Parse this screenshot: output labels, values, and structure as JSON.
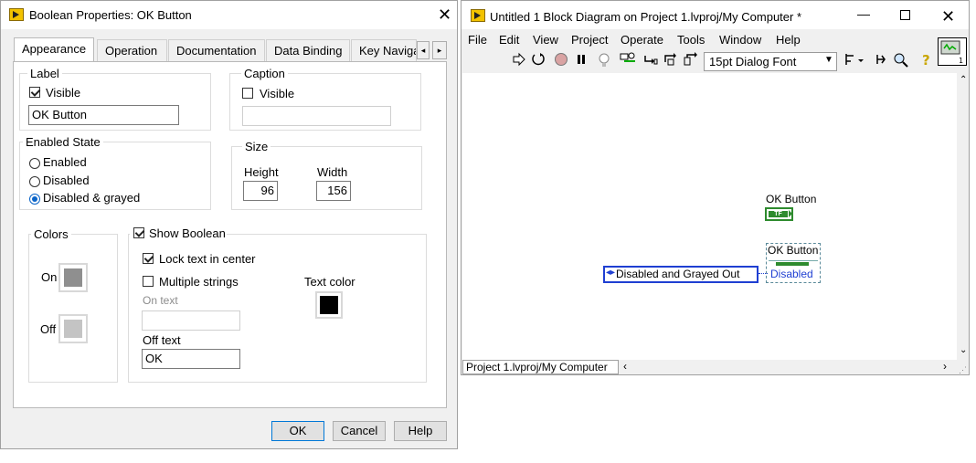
{
  "dialog": {
    "title": "Boolean Properties: OK Button",
    "tabs": [
      "Appearance",
      "Operation",
      "Documentation",
      "Data Binding",
      "Key Naviga"
    ],
    "label": {
      "legend": "Label",
      "visible_label": "Visible",
      "visible_checked": true,
      "value": "OK Button"
    },
    "caption": {
      "legend": "Caption",
      "visible_label": "Visible",
      "visible_checked": false,
      "value": ""
    },
    "enabled_state": {
      "legend": "Enabled State",
      "options": [
        "Enabled",
        "Disabled",
        "Disabled & grayed"
      ],
      "selected": "Disabled & grayed"
    },
    "size": {
      "legend": "Size",
      "height_label": "Height",
      "height": "96",
      "width_label": "Width",
      "width": "156"
    },
    "colors": {
      "legend": "Colors",
      "on_label": "On",
      "off_label": "Off",
      "on_color": "#8f8f8f",
      "off_color": "#c4c4c4"
    },
    "show_boolean": {
      "label": "Show Boolean",
      "checked": true
    },
    "lock_text": {
      "label": "Lock text in center",
      "checked": true
    },
    "multiple_strings": {
      "label": "Multiple strings",
      "checked": false
    },
    "on_text": {
      "label": "On text",
      "value": ""
    },
    "off_text": {
      "label": "Off text",
      "value": "OK"
    },
    "text_color": {
      "label": "Text color",
      "color": "#000000"
    },
    "buttons": {
      "ok": "OK",
      "cancel": "Cancel",
      "help": "Help"
    }
  },
  "window": {
    "title": "Untitled 1 Block Diagram on Project 1.lvproj/My Computer *",
    "menus": [
      "File",
      "Edit",
      "View",
      "Project",
      "Operate",
      "Tools",
      "Window",
      "Help"
    ],
    "font_select": "15pt Dialog Font",
    "diagram": {
      "terminal_label": "OK Button",
      "terminal_type": "TF",
      "property_node_label": "OK Button",
      "property_value": "Disabled",
      "enum_constant": "Disabled and Grayed Out"
    },
    "status_bar": "Project 1.lvproj/My Computer"
  }
}
